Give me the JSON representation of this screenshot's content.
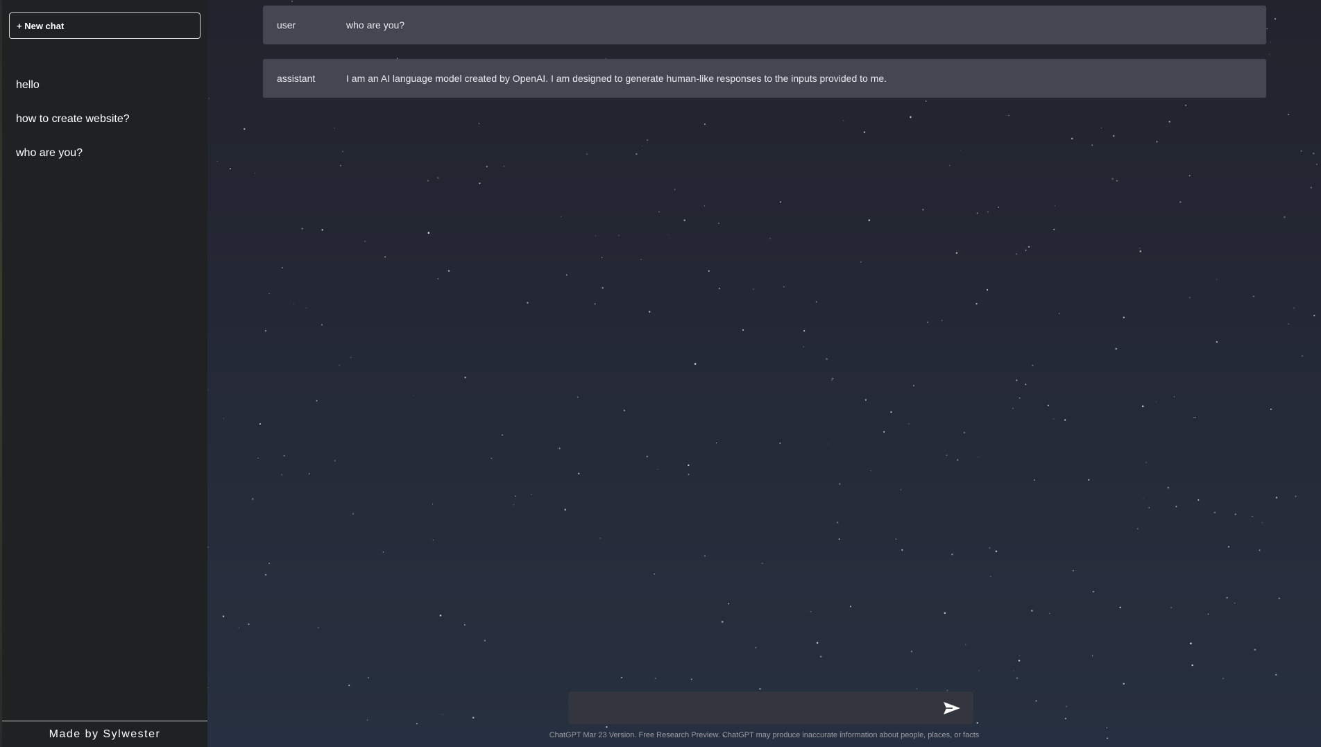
{
  "sidebar": {
    "new_chat_label": "+ New chat",
    "history": [
      "hello",
      "how to create website?",
      "who are you?"
    ],
    "footer": "Made by Sylwester"
  },
  "messages": [
    {
      "role": "user",
      "content": "who are you?"
    },
    {
      "role": "assistant",
      "content": "I am an AI language model created by OpenAI. I am designed to generate human-like responses to the inputs provided to me."
    }
  ],
  "composer": {
    "value": "",
    "placeholder": "",
    "send_icon": "send-arrow-icon"
  },
  "disclaimer": "ChatGPT Mar 23 Version. Free Research Preview. ChatGPT may produce inaccurate information about people, places, or facts",
  "colors": {
    "sidebar_bg": "#202123",
    "message_bg": "#454652",
    "page_bg": "#232631"
  }
}
